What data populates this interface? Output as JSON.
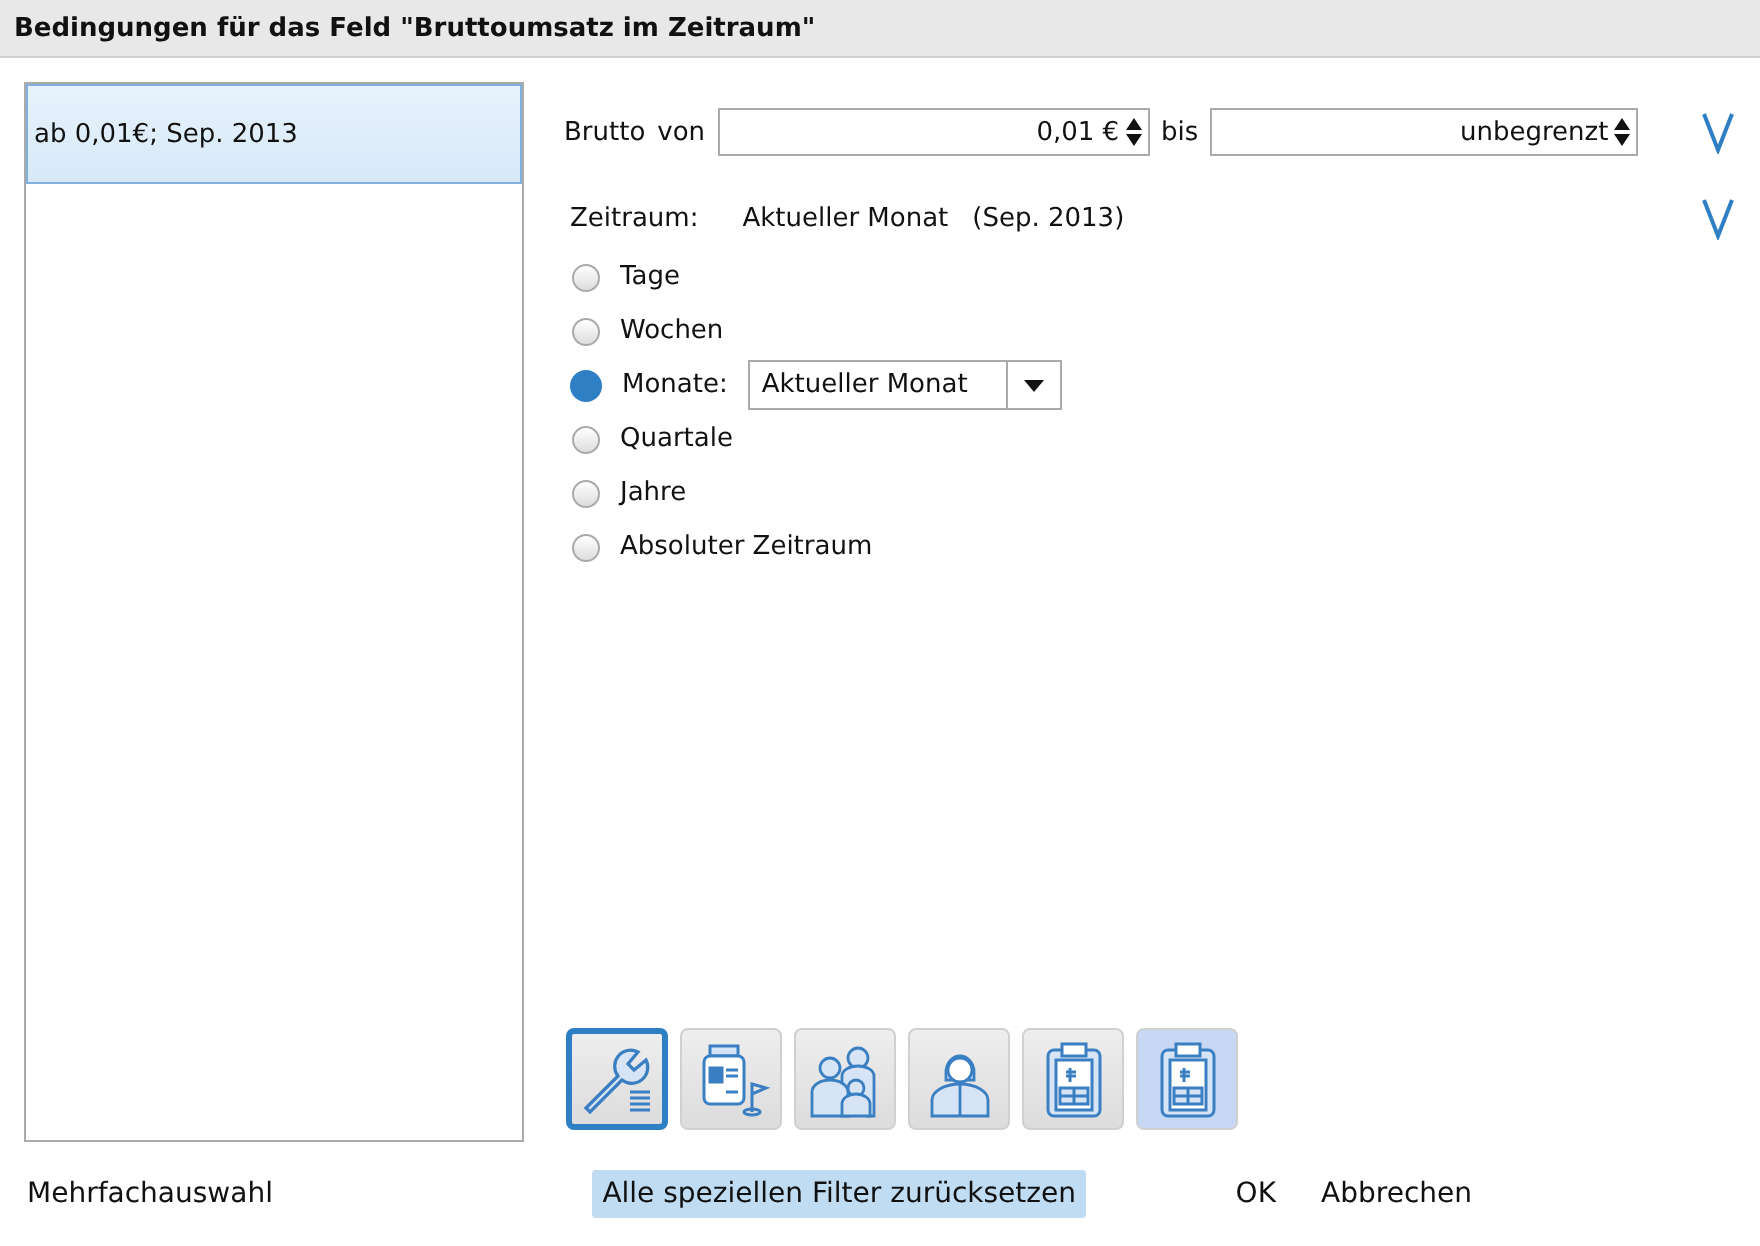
{
  "window": {
    "title": "Bedingungen für das Feld \"Bruttoumsatz im Zeitraum\""
  },
  "conditions": [
    {
      "label": "ab 0,01€; Sep. 2013",
      "selected": true
    }
  ],
  "brutto": {
    "label": "Brutto",
    "from_label": "von",
    "from_value": "0,01 €",
    "to_label": "bis",
    "to_value": "unbegrenzt"
  },
  "period": {
    "label": "Zeitraum:",
    "value": "Aktueller Monat",
    "note": "(Sep. 2013)"
  },
  "period_options": [
    {
      "label": "Tage",
      "selected": false
    },
    {
      "label": "Wochen",
      "selected": false
    },
    {
      "label": "Monate:",
      "selected": true,
      "dropdown": "Aktueller Monat"
    },
    {
      "label": "Quartale",
      "selected": false
    },
    {
      "label": "Jahre",
      "selected": false
    },
    {
      "label": "Absoluter Zeitraum",
      "selected": false
    }
  ],
  "filter_tools": [
    {
      "kind": "wrench",
      "selected": true,
      "highlighted": false
    },
    {
      "kind": "jar",
      "selected": false,
      "highlighted": false
    },
    {
      "kind": "family",
      "selected": false,
      "highlighted": false
    },
    {
      "kind": "person",
      "selected": false,
      "highlighted": false
    },
    {
      "kind": "clipboard",
      "selected": false,
      "highlighted": false
    },
    {
      "kind": "clipboard",
      "selected": false,
      "highlighted": true
    }
  ],
  "buttons": [
    {
      "label": "Mehrfachauswahl",
      "highlighted": false
    },
    {
      "label": "Alle speziellen Filter zurücksetzen",
      "highlighted": true
    },
    {
      "label": "OK",
      "highlighted": false
    },
    {
      "label": "Abbrechen",
      "highlighted": false
    }
  ]
}
